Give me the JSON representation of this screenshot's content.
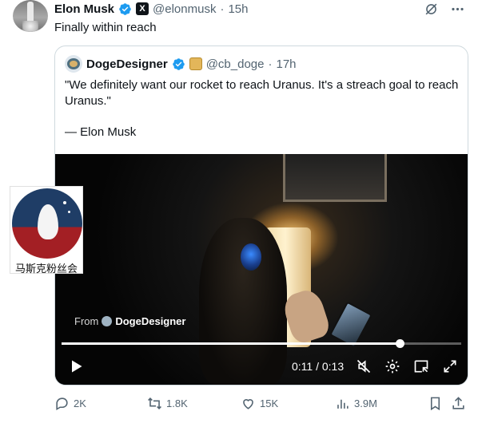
{
  "tweet": {
    "author_name": "Elon Musk",
    "author_handle": "@elonmusk",
    "time": "15h",
    "text": "Finally within reach",
    "x_badge": "X"
  },
  "quote": {
    "author_name": "DogeDesigner",
    "author_handle": "@cb_doge",
    "time": "17h",
    "text": "\"We definitely want our rocket to reach Uranus. It's a streach goal to reach Uranus.\"",
    "signature": "— Elon Musk"
  },
  "video": {
    "from_label": "From",
    "from_source": "DogeDesigner",
    "time_display": "0:11 / 0:13",
    "progress": 0.846
  },
  "watermark": {
    "text": "马斯克粉丝会"
  },
  "actions": {
    "replies": "2K",
    "reposts": "1.8K",
    "likes": "15K",
    "views": "3.9M"
  },
  "colors": {
    "verified": "#1d9bf0",
    "muted": "#536471",
    "border": "#cfd9de"
  },
  "icons": [
    "grok-slash-icon",
    "more-icon",
    "play-icon",
    "mute-icon",
    "settings-icon",
    "pip-icon",
    "fullscreen-icon",
    "reply-icon",
    "repost-icon",
    "like-icon",
    "views-icon",
    "bookmark-icon",
    "share-icon"
  ]
}
